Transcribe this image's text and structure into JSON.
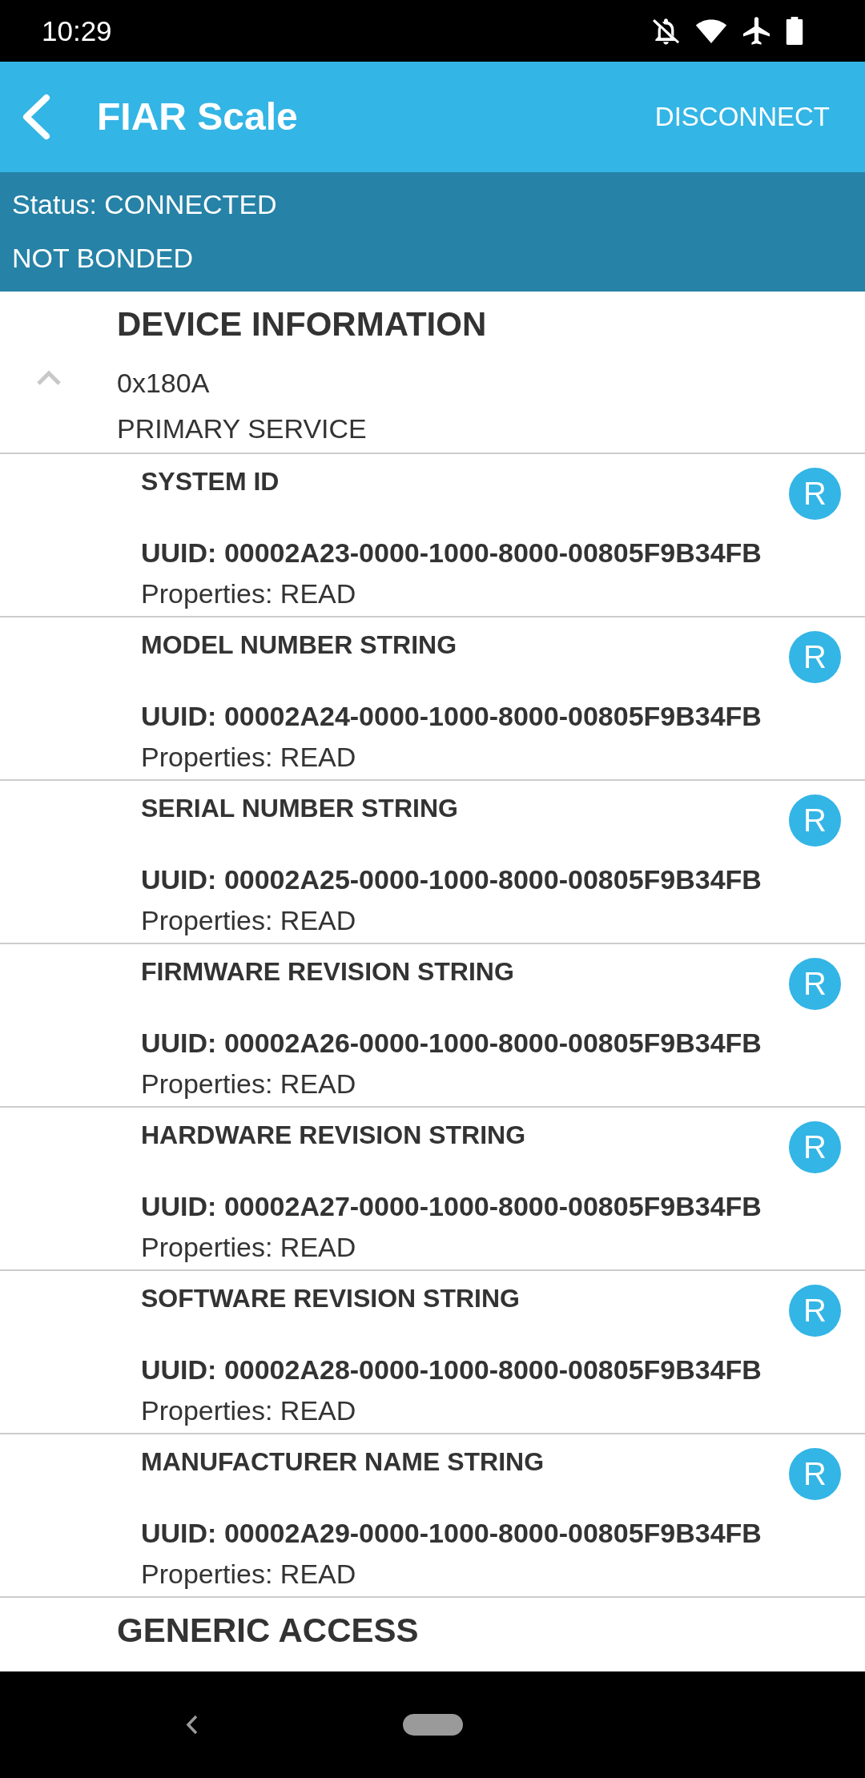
{
  "status_bar": {
    "time": "10:29"
  },
  "app_bar": {
    "title": "FIAR Scale",
    "action": "DISCONNECT"
  },
  "connection": {
    "status": "Status: CONNECTED",
    "bonding": "NOT BONDED"
  },
  "services": [
    {
      "name": "DEVICE INFORMATION",
      "uuid": "0x180A",
      "type": "PRIMARY SERVICE",
      "expanded": true,
      "characteristics": [
        {
          "name": "SYSTEM ID",
          "uuid": "UUID: 00002A23-0000-1000-8000-00805F9B34FB",
          "properties": "Properties: READ",
          "buttons": [
            "R"
          ]
        },
        {
          "name": "MODEL NUMBER STRING",
          "uuid": "UUID: 00002A24-0000-1000-8000-00805F9B34FB",
          "properties": "Properties: READ",
          "buttons": [
            "R"
          ]
        },
        {
          "name": "SERIAL NUMBER STRING",
          "uuid": "UUID: 00002A25-0000-1000-8000-00805F9B34FB",
          "properties": "Properties: READ",
          "buttons": [
            "R"
          ]
        },
        {
          "name": "FIRMWARE REVISION STRING",
          "uuid": "UUID: 00002A26-0000-1000-8000-00805F9B34FB",
          "properties": "Properties: READ",
          "buttons": [
            "R"
          ]
        },
        {
          "name": "HARDWARE REVISION STRING",
          "uuid": "UUID: 00002A27-0000-1000-8000-00805F9B34FB",
          "properties": "Properties: READ",
          "buttons": [
            "R"
          ]
        },
        {
          "name": "SOFTWARE REVISION STRING",
          "uuid": "UUID: 00002A28-0000-1000-8000-00805F9B34FB",
          "properties": "Properties: READ",
          "buttons": [
            "R"
          ]
        },
        {
          "name": "MANUFACTURER NAME STRING",
          "uuid": "UUID: 00002A29-0000-1000-8000-00805F9B34FB",
          "properties": "Properties: READ",
          "buttons": [
            "R"
          ]
        }
      ]
    },
    {
      "name": "GENERIC ACCESS"
    }
  ]
}
